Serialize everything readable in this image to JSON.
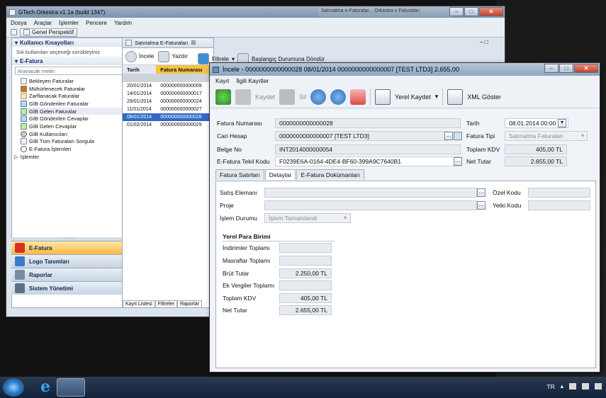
{
  "back_window": {
    "title": "GTech Orkestra v1.1a (build 1347)",
    "ghost_title": "Satınalma e-Faturalar... Orkestra v Faturaları",
    "menu": [
      "Dosya",
      "Araçlar",
      "İşlemler",
      "Pencere",
      "Yardım"
    ],
    "perspective_label": "Genel Perspektif",
    "shortcuts_header": "Kullanıcı Kısayolları",
    "shortcuts_hint": "Sık kullanılan seçeneği sürükleyiniz",
    "efatura_header": "E-Fatura",
    "search_placeholder": "Aranacak metin",
    "tree": [
      {
        "label": "Bekleyen Faturalar",
        "icon": "doc-icon"
      },
      {
        "label": "Mühürlenecek Faturalar",
        "icon": "stamp-icon"
      },
      {
        "label": "Zarflanacak Faturalar",
        "icon": "envelope-icon"
      },
      {
        "label": "GİB Gönderilen Faturalar",
        "icon": "outbox-icon"
      },
      {
        "label": "GİB Gelen Faturalar",
        "icon": "inbox-icon"
      },
      {
        "label": "GİB Gönderilen Cevaplar",
        "icon": "outbox-icon"
      },
      {
        "label": "GİB Gelen Cevaplar",
        "icon": "inbox-icon"
      },
      {
        "label": "GİB Kullanıcıları",
        "icon": "users-icon"
      },
      {
        "label": "GİB Tüm Faturaları Sorgula",
        "icon": "doc-icon"
      },
      {
        "label": "E-Fatura İşlemleri",
        "icon": "magnifier-icon"
      },
      {
        "label": "İşlemler",
        "icon": "expand-icon"
      }
    ],
    "nav_buttons": [
      "E-Fatura",
      "Logo Tanımları",
      "Raporlar",
      "Sistem Yönetimi"
    ],
    "tab_title": "Satınalma E-Faturaları",
    "toolbar": {
      "incele": "İncele",
      "yazdir": "Yazdır",
      "filtrele": "Filtrele",
      "reset": "Başlangıç Durumuna Döndür"
    },
    "grid_columns": [
      "Tarih",
      "Fatura Numarası"
    ],
    "grid_rows": [
      {
        "tarih": "20/01/2014",
        "no": "000000000000009"
      },
      {
        "tarih": "14/01/2014",
        "no": "000000000000017"
      },
      {
        "tarih": "29/01/2014",
        "no": "000000000000024"
      },
      {
        "tarih": "11/01/2014",
        "no": "000000000000027"
      },
      {
        "tarih": "08/01/2014",
        "no": "000000000000028"
      },
      {
        "tarih": "01/02/2014",
        "no": "000000000000029"
      }
    ],
    "bottom_tabs": [
      "Kayıt Listesi",
      "Filtreler",
      "Raporlar"
    ]
  },
  "dialog": {
    "title": "İncele - 0000000000000028 08/01/2014 0000000000000007 [TEST LTD3] 2.655,00",
    "menu": [
      "Kayıt",
      "İlgili Kayıtlar"
    ],
    "toolbar": {
      "kaydet": "Kaydet",
      "sil": "Sil",
      "yerel_kaydet": "Yerel Kaydet",
      "xml_goster": "XML Göster"
    },
    "fields": {
      "fatura_numarasi_label": "Fatura Numarası",
      "fatura_numarasi": "0000000000000028",
      "cari_hesap_label": "Cari Hesap",
      "cari_hesap": "0000000000000007 [TEST LTD3]",
      "belge_no_label": "Belge No",
      "belge_no": "INT2014000000054",
      "tekil_kod_label": "E-Fatura Tekil Kodu",
      "tekil_kod": "F0239E6A-0164-4DE4-BF60-399A9C7640B1",
      "tarih_label": "Tarih",
      "tarih": "08.01.2014 00:00",
      "fatura_tipi_label": "Fatura Tipi",
      "fatura_tipi": "Satınalma Faturaları",
      "toplam_kdv_label": "Toplam KDV",
      "toplam_kdv": "405,00 TL",
      "net_tutar_label": "Net Tutar",
      "net_tutar": "2.655,00 TL"
    },
    "tabs": [
      "Fatura Satırları",
      "Detaylar",
      "E-Fatura Dokümanları"
    ],
    "details": {
      "satis_elemani_label": "Satış Elemanı",
      "proje_label": "Proje",
      "islem_durumu_label": "İşlem Durumu",
      "islem_durumu": "İşlem Tamamlandı",
      "ozel_kodu_label": "Özel Kodu",
      "yetki_kodu_label": "Yetki Kodu",
      "yerel_para_birimi": "Yerel Para Birimi",
      "rows": [
        {
          "label": "İndirimler Toplamı",
          "value": ""
        },
        {
          "label": "Masraflar Toplamı",
          "value": ""
        },
        {
          "label": "Brüt Tutar",
          "value": "2.250,00 TL"
        },
        {
          "label": "Ek Vergiler Toplamı",
          "value": ""
        },
        {
          "label": "Toplam KDV",
          "value": "405,00 TL"
        },
        {
          "label": "Net Tutar",
          "value": "2.655,00 TL"
        }
      ]
    }
  },
  "taskbar": {
    "lang": "TR"
  }
}
